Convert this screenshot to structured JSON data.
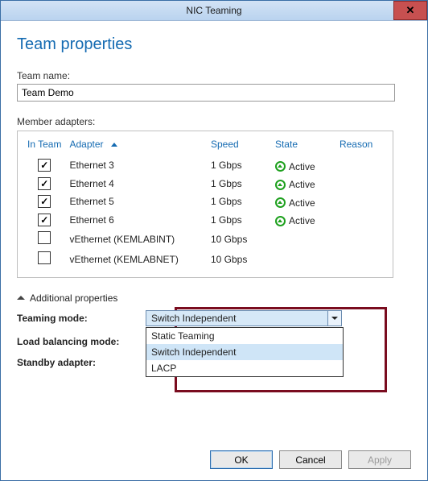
{
  "window": {
    "title": "NIC Teaming"
  },
  "page": {
    "heading": "Team properties"
  },
  "team_name": {
    "label": "Team name:",
    "value": "Team Demo"
  },
  "members": {
    "label": "Member adapters:",
    "columns": {
      "inteam": "In Team",
      "adapter": "Adapter",
      "speed": "Speed",
      "state": "State",
      "reason": "Reason"
    },
    "rows": [
      {
        "checked": true,
        "adapter": "Ethernet 3",
        "speed": "1 Gbps",
        "state": "Active",
        "up": true
      },
      {
        "checked": true,
        "adapter": "Ethernet 4",
        "speed": "1 Gbps",
        "state": "Active",
        "up": true
      },
      {
        "checked": true,
        "adapter": "Ethernet 5",
        "speed": "1 Gbps",
        "state": "Active",
        "up": true
      },
      {
        "checked": true,
        "adapter": "Ethernet 6",
        "speed": "1 Gbps",
        "state": "Active",
        "up": true
      },
      {
        "checked": false,
        "adapter": "vEthernet (KEMLABINT)",
        "speed": "10 Gbps",
        "state": "",
        "up": false
      },
      {
        "checked": false,
        "adapter": "vEthernet (KEMLABNET)",
        "speed": "10 Gbps",
        "state": "",
        "up": false
      }
    ]
  },
  "additional": {
    "toggle_label": "Additional properties",
    "teaming_mode": {
      "label": "Teaming mode:",
      "value": "Switch Independent",
      "options": [
        "Static Teaming",
        "Switch Independent",
        "LACP"
      ]
    },
    "load_balancing": {
      "label": "Load balancing mode:"
    },
    "standby": {
      "label": "Standby adapter:"
    }
  },
  "buttons": {
    "ok": "OK",
    "cancel": "Cancel",
    "apply": "Apply"
  }
}
